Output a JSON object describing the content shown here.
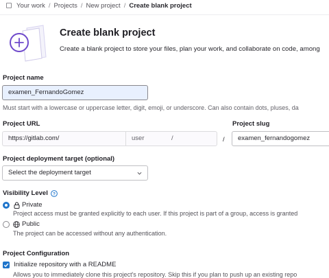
{
  "breadcrumb": {
    "items": [
      "Your work",
      "Projects",
      "New project"
    ],
    "current": "Create blank project",
    "separator": "/"
  },
  "header": {
    "title": "Create blank project",
    "subtitle": "Create a blank project to store your files, plan your work, and collaborate on code, among"
  },
  "project_name": {
    "label": "Project name",
    "value": "examen_FernandoGomez",
    "help": "Must start with a lowercase or uppercase letter, digit, emoji, or underscore. Can also contain dots, pluses, da"
  },
  "project_url": {
    "label": "Project URL",
    "prefix": "https://gitlab.com/",
    "namespace": "user",
    "trailing_slash": "/",
    "separator": "/"
  },
  "project_slug": {
    "label": "Project slug",
    "value": "examen_fernandogomez"
  },
  "deployment": {
    "label": "Project deployment target (optional)",
    "selected": "Select the deployment target"
  },
  "visibility": {
    "label": "Visibility Level",
    "options": [
      {
        "label": "Private",
        "checked": true,
        "description": "Project access must be granted explicitly to each user. If this project is part of a group, access is granted"
      },
      {
        "label": "Public",
        "checked": false,
        "description": "The project can be accessed without any authentication."
      }
    ]
  },
  "configuration": {
    "label": "Project Configuration",
    "readme_label": "Initialize repository with a README",
    "readme_checked": true,
    "readme_help": "Allows you to immediately clone this project's repository. Skip this if you plan to push up an existing repo"
  },
  "colors": {
    "accent": "#1f75cb",
    "illustration_purple": "#6e49cb",
    "text": "#28272d",
    "muted": "#626168"
  },
  "icons": [
    "home-icon",
    "plus-circle-icon",
    "question-circle-icon",
    "lock-icon",
    "earth-icon",
    "chevron-down-icon",
    "check-icon"
  ]
}
